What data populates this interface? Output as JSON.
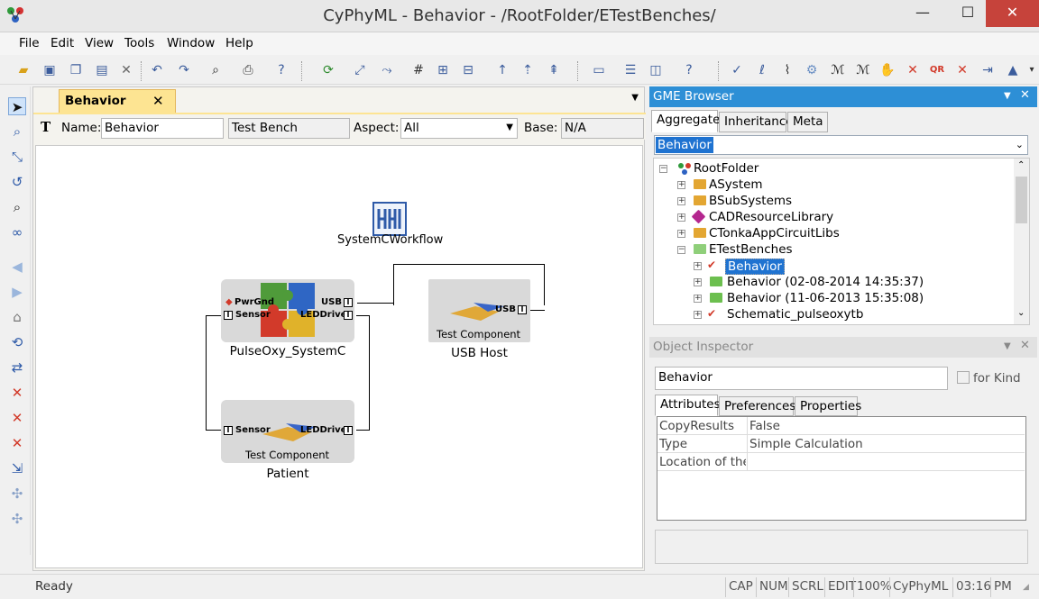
{
  "window": {
    "title": "CyPhyML - Behavior - /RootFolder/ETestBenches/",
    "minimize_glyph": "—",
    "maximize_glyph": "☐",
    "close_glyph": "✕"
  },
  "menu": [
    "File",
    "Edit",
    "View",
    "Tools",
    "Window",
    "Help"
  ],
  "editor": {
    "tab_label": "Behavior",
    "tab_close": "✕",
    "name_label": "Name:",
    "name_value": "Behavior",
    "kind_value": "Test Bench",
    "aspect_label": "Aspect:",
    "aspect_value": "All",
    "base_label": "Base:",
    "base_value": "N/A",
    "components": {
      "workflow": {
        "name": "SystemCWorkflow"
      },
      "pulseoxy": {
        "name": "PulseOxy_SystemC",
        "ports": {
          "pwrgnd": "PwrGnd",
          "usb": "USB",
          "sensor": "Sensor",
          "leddrive": "LEDDrive"
        }
      },
      "usbhost": {
        "name": "USB Host",
        "inner": "Test Component",
        "port": "USB"
      },
      "patient": {
        "name": "Patient",
        "inner": "Test Component",
        "ports": {
          "sensor": "Sensor",
          "leddrive": "LEDDrive"
        }
      }
    }
  },
  "browser": {
    "title": "GME Browser",
    "tabs": [
      "Aggregate",
      "Inheritance",
      "Meta"
    ],
    "active_tab": "Aggregate",
    "filter_value": "Behavior",
    "tree": [
      {
        "label": "RootFolder",
        "icon": "root-icon"
      },
      {
        "label": "ASystem",
        "icon": "folder-icon"
      },
      {
        "label": "BSubSystems",
        "icon": "folder-icon"
      },
      {
        "label": "CADResourceLibrary",
        "icon": "library-icon"
      },
      {
        "label": "CTonkaAppCircuitLibs",
        "icon": "folder-icon"
      },
      {
        "label": "ETestBenches",
        "icon": "folder-open-icon"
      },
      {
        "label": "Behavior",
        "icon": "testbench-icon"
      },
      {
        "label": "Behavior (02-08-2014 14:35:37)",
        "icon": "folder-green-icon"
      },
      {
        "label": "Behavior (11-06-2013 15:35:08)",
        "icon": "folder-green-icon"
      },
      {
        "label": "Schematic_pulseoxytb",
        "icon": "testbench-icon"
      }
    ]
  },
  "inspector": {
    "title": "Object Inspector",
    "name_value": "Behavior",
    "for_kind_label": "for Kind",
    "tabs": [
      "Attributes",
      "Preferences",
      "Properties"
    ],
    "attributes": [
      {
        "key": "CopyResults",
        "value": "False"
      },
      {
        "key": "Type",
        "value": "Simple Calculation"
      },
      {
        "key": "Location of the sp",
        "value": ""
      }
    ]
  },
  "status": {
    "text": "Ready",
    "indicators": [
      "CAP",
      "NUM",
      "SCRL",
      "EDIT",
      "100%",
      "CyPhyML",
      "03:16",
      "PM"
    ]
  },
  "colors": {
    "titlebar": "#e8e8e8",
    "close_button": "#c6433b",
    "tab_active": "#fde492",
    "pane_header": "#2d8fd6",
    "selection": "#1f73d1"
  }
}
